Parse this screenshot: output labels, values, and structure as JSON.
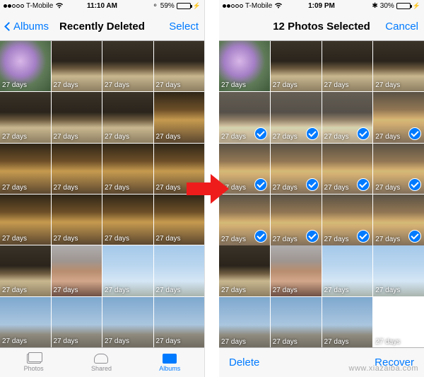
{
  "colors": {
    "accent": "#007aff",
    "battery_green": "#3ac426"
  },
  "left_phone": {
    "status": {
      "carrier": "T-Mobile",
      "wifi": true,
      "time": "11:10 AM",
      "battery_pct": "59%",
      "charging": true,
      "signal_filled": 2
    },
    "nav": {
      "back_label": "Albums",
      "title": "Recently Deleted",
      "right_label": "Select"
    },
    "grid": [
      {
        "remaining": "27 days",
        "img": "flower"
      },
      {
        "remaining": "27 days",
        "img": "station"
      },
      {
        "remaining": "27 days",
        "img": "station"
      },
      {
        "remaining": "27 days",
        "img": "station"
      },
      {
        "remaining": "27 days",
        "img": "station"
      },
      {
        "remaining": "27 days",
        "img": "station"
      },
      {
        "remaining": "27 days",
        "img": "station"
      },
      {
        "remaining": "27 days",
        "img": "hall"
      },
      {
        "remaining": "27 days",
        "img": "hall"
      },
      {
        "remaining": "27 days",
        "img": "hall"
      },
      {
        "remaining": "27 days",
        "img": "hall"
      },
      {
        "remaining": "27 days",
        "img": "hall"
      },
      {
        "remaining": "27 days",
        "img": "hall"
      },
      {
        "remaining": "27 days",
        "img": "hall"
      },
      {
        "remaining": "27 days",
        "img": "hall"
      },
      {
        "remaining": "27 days",
        "img": "hall"
      },
      {
        "remaining": "27 days",
        "img": "station"
      },
      {
        "remaining": "27 days",
        "img": "selfie"
      },
      {
        "remaining": "27 days",
        "img": "sky"
      },
      {
        "remaining": "27 days",
        "img": "sky"
      },
      {
        "remaining": "27 days",
        "img": "skyline"
      },
      {
        "remaining": "27 days",
        "img": "skyline"
      },
      {
        "remaining": "27 days",
        "img": "skyline"
      },
      {
        "remaining": "27 days",
        "img": "skyline"
      }
    ],
    "tabs": {
      "photos": "Photos",
      "shared": "Shared",
      "albums": "Albums",
      "active": "albums"
    }
  },
  "right_phone": {
    "status": {
      "carrier": "T-Mobile",
      "wifi": true,
      "time": "1:09 PM",
      "battery_pct": "30%",
      "charging": true,
      "signal_filled": 2
    },
    "nav": {
      "title": "12 Photos Selected",
      "right_label": "Cancel"
    },
    "grid": [
      {
        "remaining": "27 days",
        "img": "flower",
        "selected": false
      },
      {
        "remaining": "27 days",
        "img": "station",
        "selected": false
      },
      {
        "remaining": "27 days",
        "img": "station",
        "selected": false
      },
      {
        "remaining": "27 days",
        "img": "station",
        "selected": false
      },
      {
        "remaining": "27 days",
        "img": "station",
        "selected": true
      },
      {
        "remaining": "27 days",
        "img": "station",
        "selected": true
      },
      {
        "remaining": "27 days",
        "img": "station",
        "selected": true
      },
      {
        "remaining": "27 days",
        "img": "hall",
        "selected": true
      },
      {
        "remaining": "27 days",
        "img": "hall",
        "selected": true
      },
      {
        "remaining": "27 days",
        "img": "hall",
        "selected": true
      },
      {
        "remaining": "27 days",
        "img": "hall",
        "selected": true
      },
      {
        "remaining": "27 days",
        "img": "hall",
        "selected": true
      },
      {
        "remaining": "27 days",
        "img": "hall",
        "selected": true
      },
      {
        "remaining": "27 days",
        "img": "hall",
        "selected": true
      },
      {
        "remaining": "27 days",
        "img": "hall",
        "selected": true
      },
      {
        "remaining": "27 days",
        "img": "hall",
        "selected": true
      },
      {
        "remaining": "27 days",
        "img": "station",
        "selected": false
      },
      {
        "remaining": "27 days",
        "img": "selfie",
        "selected": false
      },
      {
        "remaining": "27 days",
        "img": "sky",
        "selected": false
      },
      {
        "remaining": "27 days",
        "img": "sky",
        "selected": false
      },
      {
        "remaining": "27 days",
        "img": "skyline",
        "selected": false
      },
      {
        "remaining": "27 days",
        "img": "skyline",
        "selected": false
      },
      {
        "remaining": "27 days",
        "img": "skyline",
        "selected": false
      },
      {
        "remaining": "27 days",
        "img": "white",
        "selected": false
      }
    ],
    "toolbar": {
      "delete_label": "Delete",
      "recover_label": "Recover"
    }
  },
  "watermark": "www.xiazaiba.com"
}
